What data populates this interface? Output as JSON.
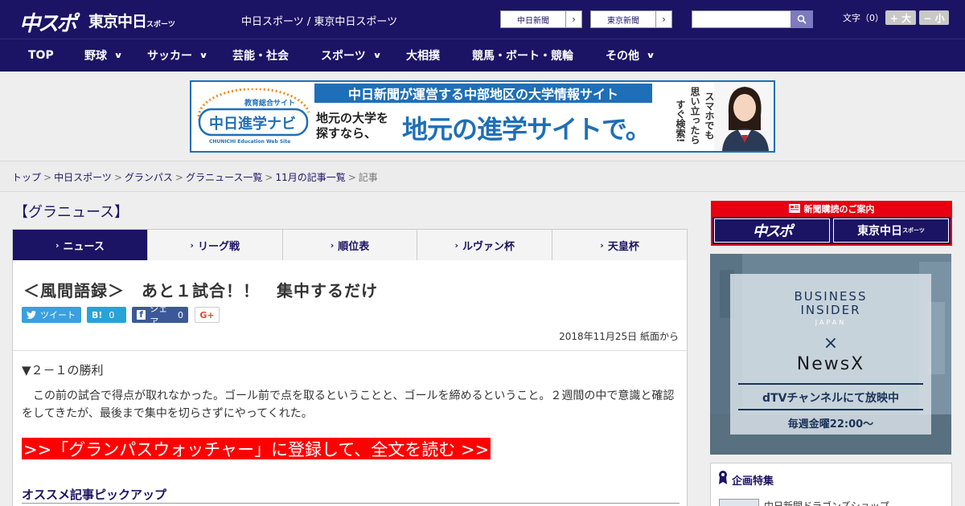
{
  "header": {
    "logo_primary": "中スポ",
    "logo_secondary": "東京中日",
    "logo_secondary_small": "スポーツ",
    "site_title": "中日スポーツ / 東京中日スポーツ",
    "link_chunichi": "中日新聞",
    "link_tokyo": "東京新聞",
    "search_placeholder": "",
    "font_size_label": "文字（0）",
    "font_larger": "+ 大",
    "font_smaller": "− 小"
  },
  "nav": [
    {
      "label": "TOP",
      "dropdown": false
    },
    {
      "label": "野球",
      "dropdown": true
    },
    {
      "label": "サッカー",
      "dropdown": true
    },
    {
      "label": "芸能・社会",
      "dropdown": false
    },
    {
      "label": "スポーツ",
      "dropdown": true
    },
    {
      "label": "大相撲",
      "dropdown": false
    },
    {
      "label": "競馬・ボート・競輪",
      "dropdown": false
    },
    {
      "label": "その他",
      "dropdown": true
    }
  ],
  "banner": {
    "logo_top": "教育総合サイト",
    "logo_main": "中日進学ナビ",
    "logo_sub": "CHUNICHI Education Web Site",
    "top_text": "中日新聞が運営する中部地区の大学情報サイト",
    "sub_line1": "地元の大学を",
    "sub_line2": "探すなら、",
    "main_text": "地元の進学サイトで。",
    "vert_col1": "スマホでも",
    "vert_col2": "思い立ったら",
    "vert_col3": "すぐ検索!"
  },
  "breadcrumb": [
    {
      "label": "トップ",
      "link": true
    },
    {
      "label": "中日スポーツ",
      "link": true
    },
    {
      "label": "グランパス",
      "link": true
    },
    {
      "label": "グラニュース一覧",
      "link": true
    },
    {
      "label": "11月の記事一覧",
      "link": true
    },
    {
      "label": "記事",
      "link": false
    }
  ],
  "section_title": "【グラニュース】",
  "tabs": [
    {
      "label": "ニュース",
      "active": true
    },
    {
      "label": "リーグ戦",
      "active": false
    },
    {
      "label": "順位表",
      "active": false
    },
    {
      "label": "ルヴァン杯",
      "active": false
    },
    {
      "label": "天皇杯",
      "active": false
    }
  ],
  "article": {
    "title": "＜風間語録＞　あと１試合！！　集中するだけ",
    "share_tweet": "ツイート",
    "share_hatena_icon": "B!",
    "share_hatena_count": "0",
    "share_fb_label": "シェア",
    "share_fb_count": "0",
    "share_gplus": "G+",
    "date": "2018年11月25日 紙面から",
    "subheading": "▼２－１の勝利",
    "body": "　この前の試合で得点が取れなかった。ゴール前で点を取るということと、ゴールを締めるということ。２週間の中で意識と確認をしてきたが、最後まで集中を切らさずにやってくれた。",
    "cta": ">>「グランパスウォッチャー」に登録して、全文を読む >>",
    "pickup_title": "オススメ記事ピックアップ"
  },
  "sidebar": {
    "subscribe_head": "新聞購読のご案内",
    "subscribe_logo1": "中スポ",
    "subscribe_logo2": "東京中日",
    "subscribe_logo2_small": "スポーツ",
    "ad_line1": "BUSINESS",
    "ad_line2": "INSIDER",
    "ad_japan": "JAPAN",
    "ad_x": "×",
    "ad_newsx": "NewsX",
    "ad_dtv": "dTVチャンネルにて放映中",
    "ad_weekly": "毎週金曜22:00〜",
    "feature_title": "企画特集",
    "feature_item": "中日新聞ドラゴンズショップ"
  },
  "colors": {
    "brand_navy": "#1b1464",
    "cta_red": "#ff0000",
    "subscribe_red": "#e60012",
    "banner_blue": "#1e6fb8"
  }
}
